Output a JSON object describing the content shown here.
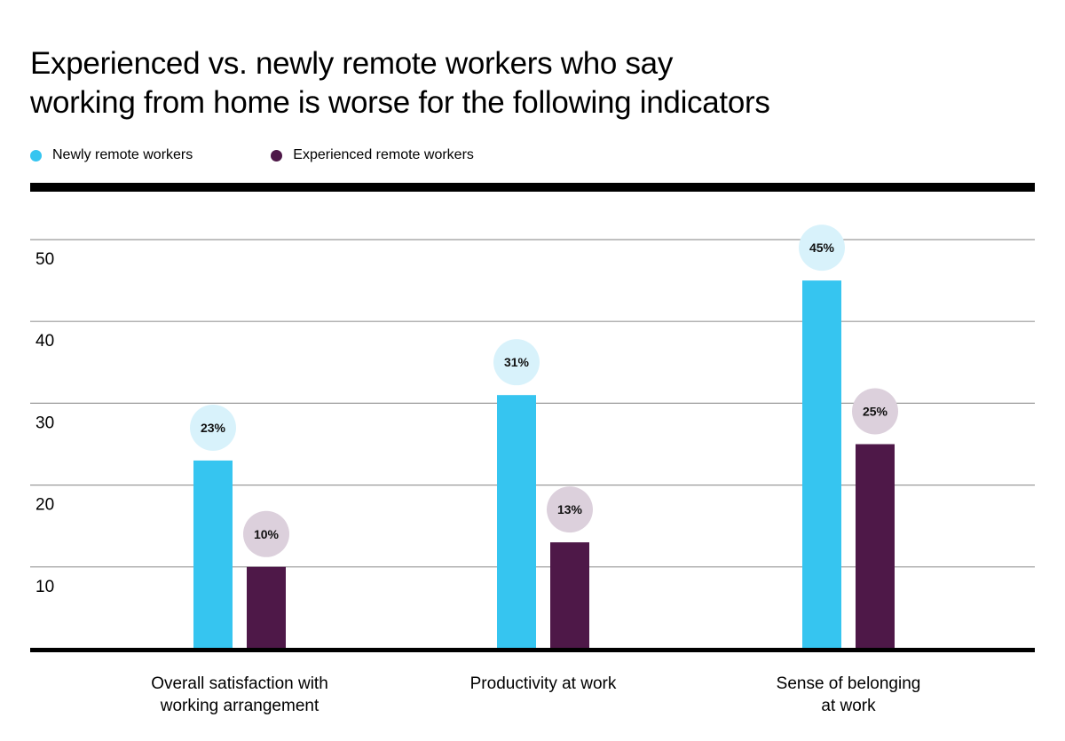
{
  "chart_data": {
    "type": "bar",
    "title": "Experienced vs. newly remote workers who say working from home is worse for the following indicators",
    "xlabel": "",
    "ylabel": "",
    "ylim": [
      0,
      50
    ],
    "yticks": [
      10,
      20,
      30,
      40,
      50
    ],
    "grid": true,
    "legend_position": "top-left",
    "categories": [
      "Overall satisfaction with working arrangement",
      "Productivity at work",
      "Sense of belonging at work"
    ],
    "category_lines": [
      [
        "Overall satisfaction with",
        "working arrangement"
      ],
      [
        "Productivity at work"
      ],
      [
        "Sense of belonging",
        "at work"
      ]
    ],
    "series": [
      {
        "name": "Newly remote workers",
        "color": "#36C5F0",
        "label_bg": "#D8F2FB",
        "values": [
          23,
          31,
          45
        ],
        "labels": [
          "23%",
          "31%",
          "45%"
        ]
      },
      {
        "name": "Experienced remote workers",
        "color": "#4E1848",
        "label_bg": "#DCD0DC",
        "values": [
          10,
          13,
          25
        ],
        "labels": [
          "10%",
          "13%",
          "25%"
        ]
      }
    ]
  },
  "title_lines": [
    "Experienced vs. newly remote workers who say",
    "working from home is worse for the following indicators"
  ]
}
